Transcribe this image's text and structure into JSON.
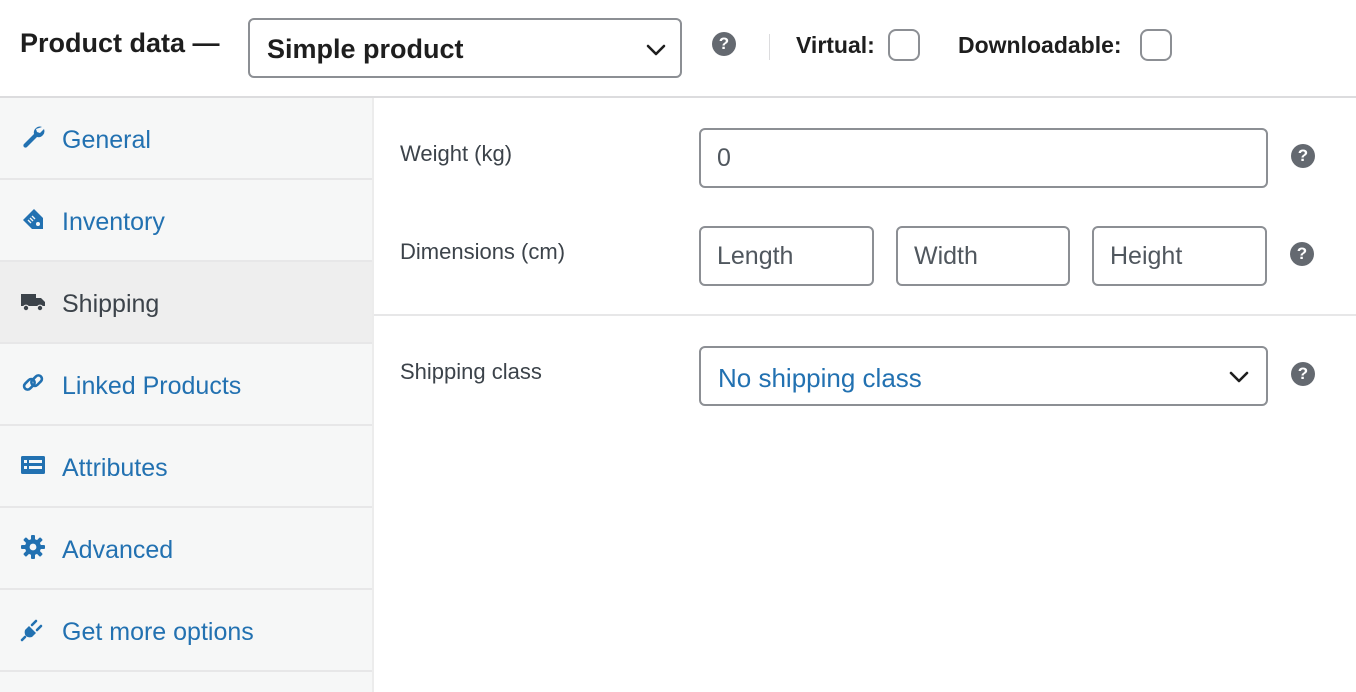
{
  "header": {
    "title": "Product data —",
    "product_type": {
      "selected": "Simple product",
      "icon": "chevron-down-icon"
    },
    "help_icon": "question-circle-icon",
    "virtual": {
      "label": "Virtual:",
      "checked": false
    },
    "downloadable": {
      "label": "Downloadable:",
      "checked": false
    }
  },
  "sidebar": {
    "tabs": [
      {
        "label": "General",
        "icon": "wrench-icon",
        "active": false
      },
      {
        "label": "Inventory",
        "icon": "tag-icon",
        "active": false
      },
      {
        "label": "Shipping",
        "icon": "truck-icon",
        "active": true
      },
      {
        "label": "Linked Products",
        "icon": "link-icon",
        "active": false
      },
      {
        "label": "Attributes",
        "icon": "list-icon",
        "active": false
      },
      {
        "label": "Advanced",
        "icon": "gear-icon",
        "active": false
      },
      {
        "label": "Get more options",
        "icon": "plugin-icon",
        "active": false
      }
    ]
  },
  "shipping": {
    "weight": {
      "label": "Weight (kg)",
      "placeholder": "0",
      "value": ""
    },
    "dimensions": {
      "label": "Dimensions (cm)",
      "length_placeholder": "Length",
      "width_placeholder": "Width",
      "height_placeholder": "Height"
    },
    "shipping_class": {
      "label": "Shipping class",
      "selected": "No shipping class"
    }
  },
  "colors": {
    "accent": "#2271b1",
    "border": "#8c8f94",
    "sidebar_bg": "#f6f7f7",
    "active_tab_bg": "#eeeeee"
  }
}
